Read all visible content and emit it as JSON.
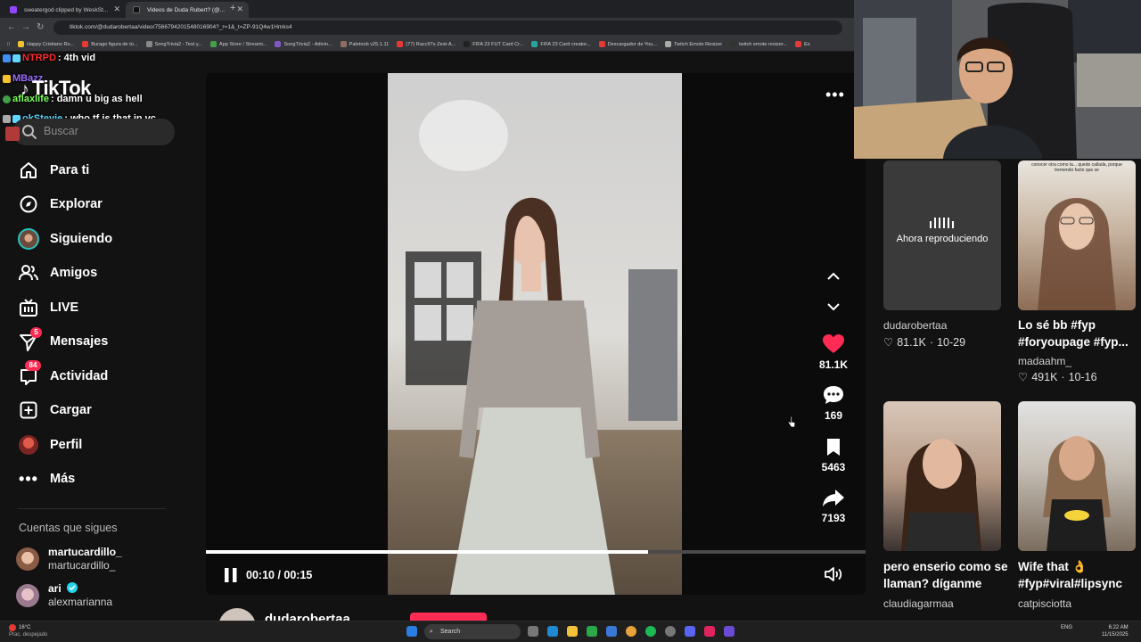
{
  "browser": {
    "tabs": [
      {
        "title": "sweatergod clipped by WeskSt..."
      },
      {
        "title": "Videos de Duda Rubert? (@..."
      }
    ],
    "url": "tiktok.com/@dudarobertaa/video/7566794201548016904?_r=1&_t=ZP-91Q4w1Hmks4",
    "bookmarks": [
      "Happy Cristiano Ro...",
      "Burago figura de to...",
      "SongTrivia2 - Test y...",
      "App Store / Streami...",
      "SongTrivia2 - Adivin...",
      "Paletoob v25.1.11",
      "(77) Racc97s Zest-A...",
      "FIFA 23 FUT Card Cr...",
      "FIFA 23 Card creator...",
      "Descargador de You...",
      "Twitch Emote Resizer",
      "twitch emote resizer...",
      "Es"
    ]
  },
  "chat": [
    {
      "user": "NTRPD",
      "message": ": 4th vid",
      "color": "#ff2b2b"
    },
    {
      "user": "MBazz",
      "message": "",
      "color": "#9b6bff"
    },
    {
      "user": "aflaxlife",
      "message": ": damn u big as hell",
      "color": "#7cff5c"
    },
    {
      "user": "okStevie",
      "message": ": who tf is that in vc",
      "color": "#5fd7ff"
    }
  ],
  "sidebar": {
    "logo": "TikTok",
    "search_placeholder": "Buscar",
    "items": [
      {
        "label": "Para ti",
        "icon": "home-icon"
      },
      {
        "label": "Explorar",
        "icon": "compass-icon"
      },
      {
        "label": "Siguiendo",
        "icon": "following-avatar-icon"
      },
      {
        "label": "Amigos",
        "icon": "friends-icon"
      },
      {
        "label": "LIVE",
        "icon": "live-tv-icon"
      },
      {
        "label": "Mensajes",
        "icon": "send-icon",
        "badge": "5"
      },
      {
        "label": "Actividad",
        "icon": "inbox-icon",
        "badge": "84"
      },
      {
        "label": "Cargar",
        "icon": "upload-plus-icon"
      },
      {
        "label": "Perfil",
        "icon": "profile-avatar-icon"
      },
      {
        "label": "Más",
        "icon": "more-dots-icon"
      }
    ],
    "following_title": "Cuentas que sigues",
    "following": [
      {
        "name": "martucardillo_",
        "handle": "martucardillo_"
      },
      {
        "name": "ari",
        "handle": "alexmarianna",
        "verified": true
      }
    ]
  },
  "player": {
    "likes": "81.1K",
    "comments": "169",
    "saves": "5463",
    "shares": "7193",
    "time": "00:10 / 00:15",
    "progress": 0.67,
    "author": "dudarobertaa",
    "like_color": "#fe2c55"
  },
  "related": [
    {
      "now_playing": "Ahora reproduciendo",
      "user": "dudarobertaa",
      "likes": "81.1K",
      "date": "10-29"
    },
    {
      "overlay": "conocer otra como la... quedo callada, porque tremendo facto que se",
      "caption": "Lo sé bb #fyp #foryoupage #fyp...",
      "user": "madaahm_",
      "likes": "491K",
      "date": "10-16"
    },
    {
      "caption": "pero enserio como se llaman? díganme",
      "user": "claudiagarmaa"
    },
    {
      "caption": "Wife that 👌 #fyp#viral#lipsync",
      "user": "catpisciotta"
    }
  ],
  "taskbar": {
    "weather_temp": "16°C",
    "weather_desc": "Prac. despejado",
    "search": "Search",
    "lang": "ENG",
    "time": "6:22 AM",
    "date": "11/15/2025"
  }
}
